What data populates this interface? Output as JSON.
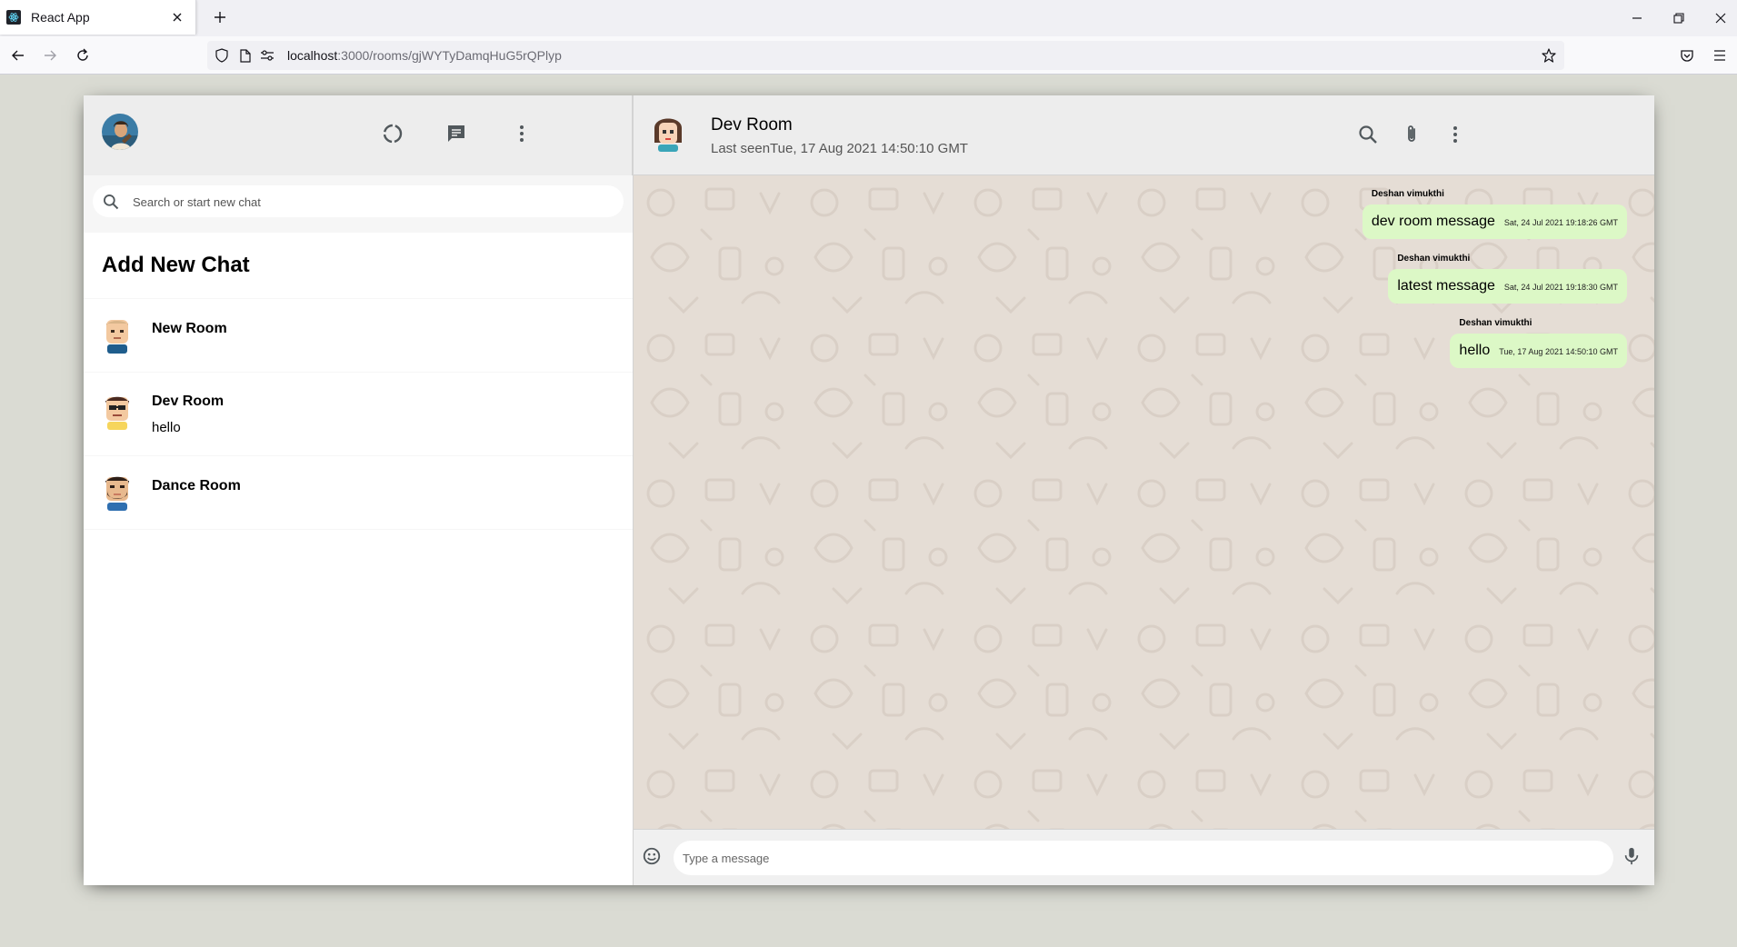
{
  "browser": {
    "tab_title": "React App",
    "url_host": "localhost",
    "url_rest": ":3000/rooms/gjWYTyDamqHuG5rQPlyp"
  },
  "sidebar": {
    "search_placeholder": "Search or start new chat",
    "add_new_chat": "Add New Chat",
    "rooms": [
      {
        "name": "New Room",
        "last_message": ""
      },
      {
        "name": "Dev Room",
        "last_message": "hello"
      },
      {
        "name": "Dance Room",
        "last_message": ""
      }
    ]
  },
  "chat": {
    "room_name": "Dev Room",
    "last_seen": "Last seenTue, 17 Aug 2021 14:50:10 GMT",
    "messages": [
      {
        "sender": "Deshan vimukthi",
        "text": "dev room message",
        "time": "Sat, 24 Jul 2021 19:18:26 GMT"
      },
      {
        "sender": "Deshan vimukthi",
        "text": "latest message",
        "time": "Sat, 24 Jul 2021 19:18:30 GMT"
      },
      {
        "sender": "Deshan vimukthi",
        "text": "hello",
        "time": "Tue, 17 Aug 2021 14:50:10 GMT"
      }
    ],
    "input_placeholder": "Type a message"
  },
  "colors": {
    "background": "#dadbd3",
    "bubble": "#dcf8c6",
    "chat_bg": "#e5ddd5",
    "header": "#ededed"
  }
}
